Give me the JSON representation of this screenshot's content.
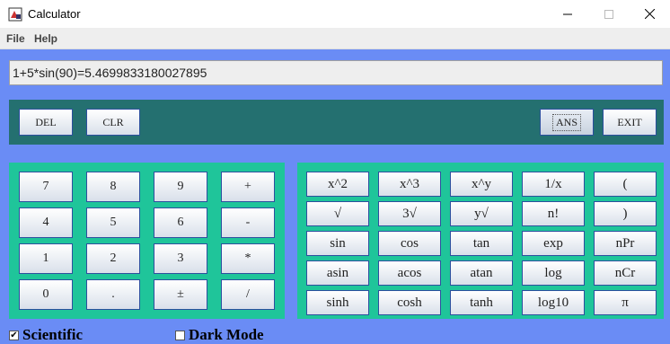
{
  "window": {
    "title": "Calculator",
    "minimize_icon": "minimize-icon",
    "maximize_icon": "maximize-icon",
    "close_icon": "close-icon"
  },
  "menu": {
    "items": [
      "File",
      "Help"
    ]
  },
  "display": {
    "value": "1+5*sin(90)=5.4699833180027895"
  },
  "top_buttons": {
    "del": "DEL",
    "clr": "CLR",
    "ans": "ANS",
    "exit": "EXIT"
  },
  "numpad": {
    "rows": [
      [
        "7",
        "8",
        "9",
        "+"
      ],
      [
        "4",
        "5",
        "6",
        "-"
      ],
      [
        "1",
        "2",
        "3",
        "*"
      ],
      [
        "0",
        ".",
        "±",
        "/"
      ]
    ]
  },
  "scientific": {
    "rows": [
      [
        "x^2",
        "x^3",
        "x^y",
        "1/x",
        "("
      ],
      [
        "√",
        "3√",
        "y√",
        "n!",
        ")"
      ],
      [
        "sin",
        "cos",
        "tan",
        "exp",
        "nPr"
      ],
      [
        "asin",
        "acos",
        "atan",
        "log",
        "nCr"
      ],
      [
        "sinh",
        "cosh",
        "tanh",
        "log10",
        "π"
      ]
    ]
  },
  "options": {
    "scientific": {
      "label": "Scientific",
      "checked": true,
      "mark": "✔"
    },
    "dark_mode": {
      "label": "Dark Mode",
      "checked": false
    }
  },
  "colors": {
    "background": "#6a8cf5",
    "top_panel": "#247070",
    "button_panel": "#1fc59a"
  }
}
